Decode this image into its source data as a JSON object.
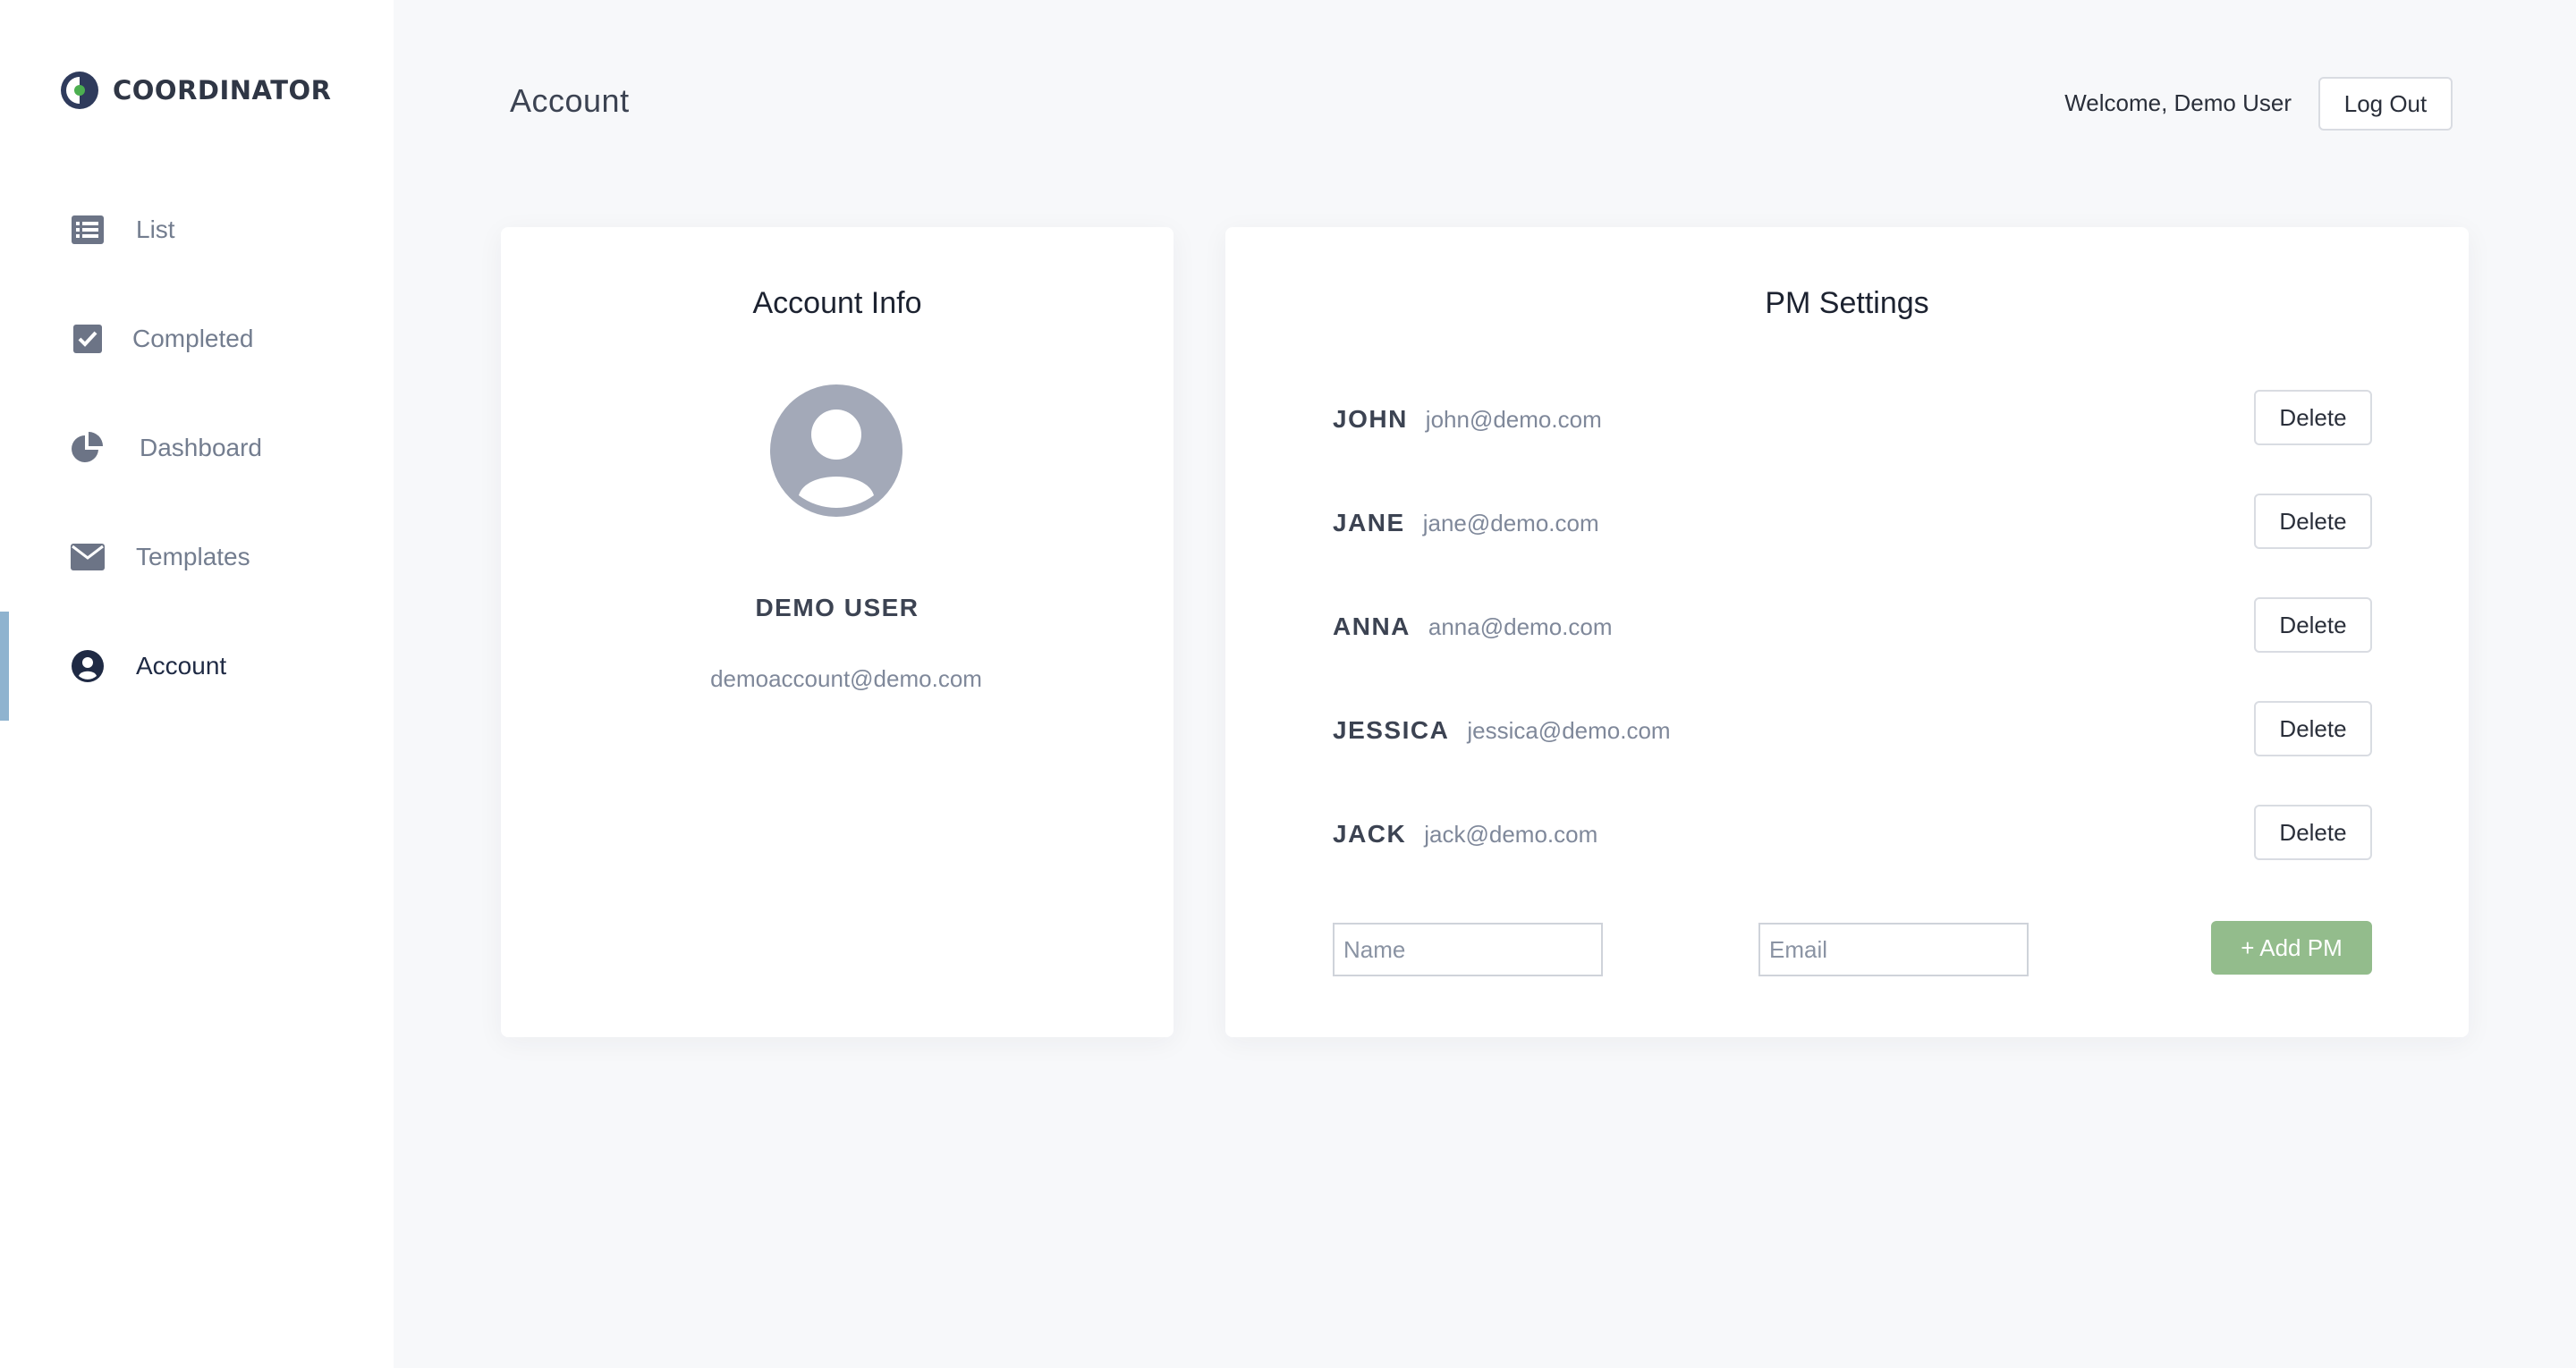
{
  "app": {
    "name": "COORDINATOR"
  },
  "sidebar": {
    "items": [
      {
        "label": "List",
        "icon": "list-icon"
      },
      {
        "label": "Completed",
        "icon": "checkbox-icon"
      },
      {
        "label": "Dashboard",
        "icon": "pie-chart-icon"
      },
      {
        "label": "Templates",
        "icon": "envelope-icon"
      },
      {
        "label": "Account",
        "icon": "user-circle-icon",
        "active": true
      }
    ]
  },
  "header": {
    "title": "Account",
    "welcome": "Welcome, Demo User",
    "logout_label": "Log Out"
  },
  "account_info": {
    "title": "Account Info",
    "name": "DEMO USER",
    "email": "demoaccount@demo.com"
  },
  "pm_settings": {
    "title": "PM Settings",
    "delete_label": "Delete",
    "pms": [
      {
        "name": "JOHN",
        "email": "john@demo.com"
      },
      {
        "name": "JANE",
        "email": "jane@demo.com"
      },
      {
        "name": "ANNA",
        "email": "anna@demo.com"
      },
      {
        "name": "JESSICA",
        "email": "jessica@demo.com"
      },
      {
        "name": "JACK",
        "email": "jack@demo.com"
      }
    ],
    "form": {
      "name_placeholder": "Name",
      "email_placeholder": "Email",
      "name_value": "",
      "email_value": "",
      "add_label": "+ Add PM"
    }
  },
  "colors": {
    "accent_green": "#93bc8c",
    "active_indicator": "#8fb3cf",
    "logo_green": "#4caf50",
    "logo_dark": "#2f3b5c"
  }
}
